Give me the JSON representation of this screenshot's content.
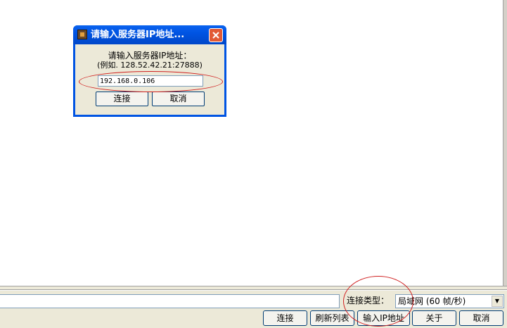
{
  "dialog": {
    "title": "请输入服务器IP地址...",
    "prompt": "请输入服务器IP地址：",
    "example": "(例如. 128.52.42.21:27888)",
    "ip_value": "192.168.0.106",
    "connect_label": "连接",
    "cancel_label": "取消"
  },
  "bottom": {
    "connection_type_label": "连接类型：",
    "connection_type_value": "局域网 (60 帧/秒)",
    "buttons": {
      "connect": "连接",
      "refresh": "刷新列表",
      "enter_ip": "输入IP地址",
      "about": "关于",
      "cancel": "取消"
    }
  },
  "icons": {
    "app": "game-app-icon",
    "close": "close-icon",
    "dropdown": "chevron-down-icon"
  },
  "colors": {
    "titlebar": "#0054e3",
    "close_button": "#e25a36",
    "panel": "#ece9d8",
    "annotation": "#d02020"
  }
}
